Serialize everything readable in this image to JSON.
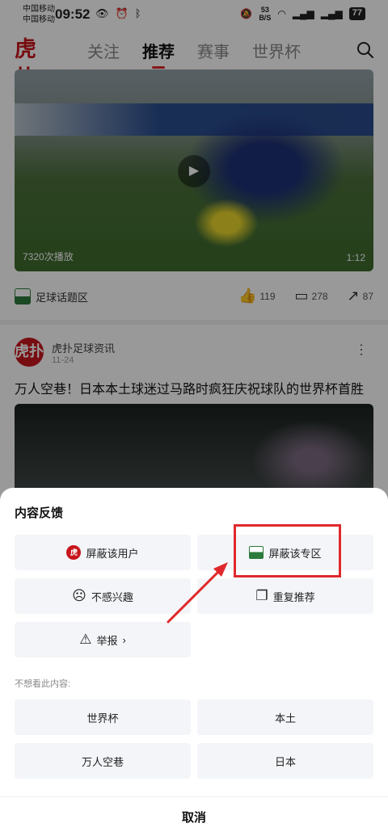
{
  "status": {
    "carrier1": "中国移动",
    "carrier2": "中国移动",
    "time": "09:52",
    "left_icons": [
      "eye-icon",
      "alarm-icon",
      "bluetooth-icon"
    ],
    "speed_value": "53",
    "speed_unit": "B/S",
    "battery": "77"
  },
  "nav": {
    "logo": "虎扑",
    "tabs": [
      "关注",
      "推荐",
      "赛事",
      "世界杯"
    ],
    "active_tab": "推荐"
  },
  "feed": {
    "video1": {
      "plays": "7320次播放",
      "duration": "1:12"
    },
    "zone_label": "足球话题区",
    "likes": "119",
    "comments": "278",
    "shares": "87",
    "post": {
      "author": "虎扑足球资讯",
      "date": "11-24",
      "title": "万人空巷！日本本土球迷过马路时疯狂庆祝球队的世界杯首胜"
    }
  },
  "sheet": {
    "title": "内容反馈",
    "options": {
      "block_user": "屏蔽该用户",
      "block_zone": "屏蔽该专区",
      "not_interested": "不感兴趣",
      "duplicate": "重复推荐",
      "report": "举报"
    },
    "sub_title": "不想看此内容:",
    "tags": [
      "世界杯",
      "本土",
      "万人空巷",
      "日本"
    ],
    "cancel": "取消"
  },
  "colors": {
    "brand": "#c8161d",
    "highlight": "#e0282c"
  }
}
